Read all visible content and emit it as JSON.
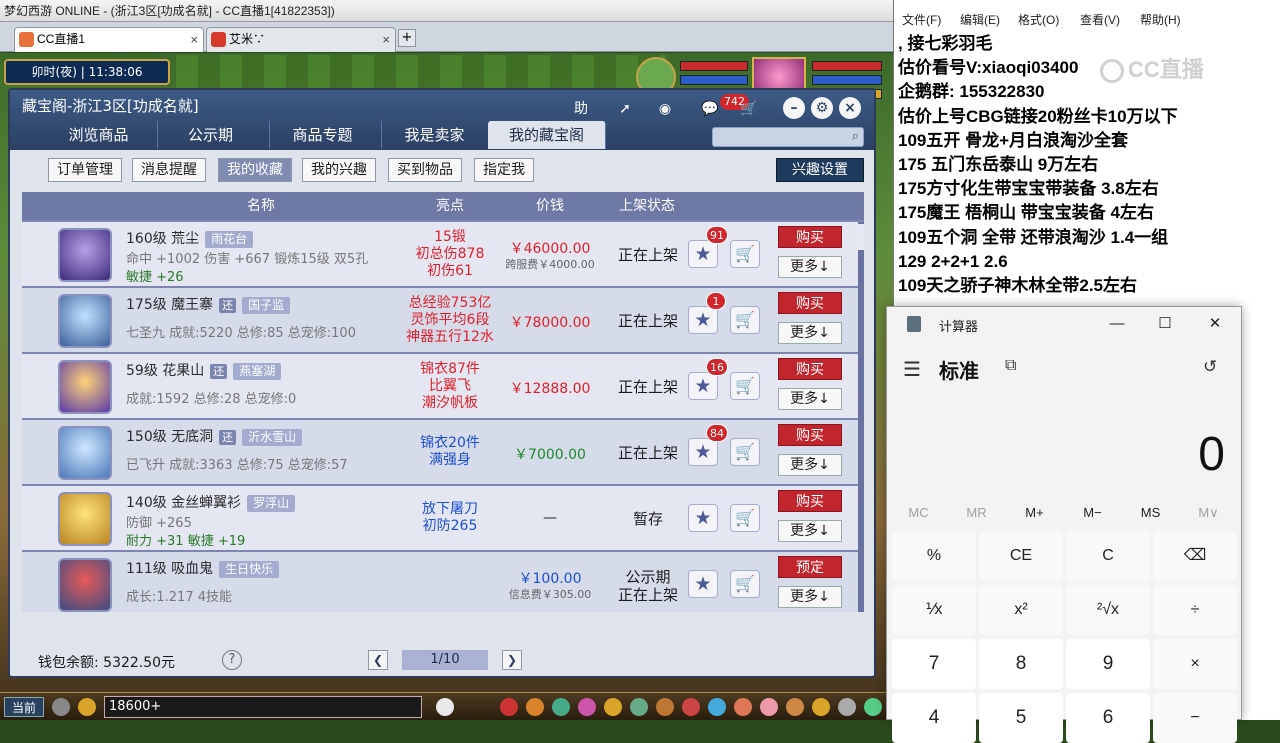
{
  "window": {
    "title": "梦幻西游 ONLINE - (浙江3区[功成名就] - CC直播1[41822353])"
  },
  "browser_tabs": [
    {
      "label": "CC直播1",
      "active": true
    },
    {
      "label": "艾米∵",
      "active": false
    }
  ],
  "browser_new_tab": "+",
  "browser_close": "×",
  "hud": {
    "clock": "卯时(夜) | 11:38:06"
  },
  "dialog": {
    "title": "藏宝阁-浙江3区[功成名就]",
    "header_buttons": {
      "help": "助",
      "message_count": "742"
    },
    "main_tabs": [
      "浏览商品",
      "公示期",
      "商品专题",
      "我是卖家",
      "我的藏宝阁"
    ],
    "active_main_tab": 4,
    "sub_tabs": [
      "订单管理",
      "消息提醒",
      "我的收藏",
      "我的兴趣",
      "买到物品",
      "指定我"
    ],
    "active_sub_tab": 2,
    "interest_settings": "兴趣设置",
    "columns": {
      "name": "名称",
      "highlight": "亮点",
      "price": "价钱",
      "status": "上架状态"
    },
    "buy_label": "购买",
    "preorder_label": "预定",
    "more_label": "更多↓",
    "rows": [
      {
        "level_name": "160级 荒尘",
        "server": "雨花台",
        "tag": "",
        "line2": "命中 +1002 伤害 +667 锻炼15级 双5孔",
        "line3": "敏捷 +26",
        "highlights": [
          "15锻",
          "初总伤878",
          "初伤61"
        ],
        "highlight_color": "red",
        "price": "￥46000.00",
        "price_color": "#e0202c",
        "fee": "跨服费￥4000.00",
        "status": [
          "正在上架"
        ],
        "badge": "91",
        "action": "buy"
      },
      {
        "level_name": "175级 魔王寨",
        "server": "国子监",
        "tag": "还",
        "line2": "七圣九 成就:5220 总修:85 总宠修:100",
        "line3": "",
        "highlights": [
          "总经验753亿",
          "灵饰平均6段",
          "神器五行12水"
        ],
        "highlight_color": "red",
        "price": "￥78000.00",
        "price_color": "#e0202c",
        "fee": "",
        "status": [
          "正在上架"
        ],
        "badge": "1",
        "action": "buy"
      },
      {
        "level_name": "59级 花果山",
        "server": "燕塞湖",
        "tag": "还",
        "line2": "成就:1592 总修:28 总宠修:0",
        "line3": "",
        "highlights": [
          "锦衣87件",
          "比翼飞",
          "潮汐帆板"
        ],
        "highlight_color": "red",
        "price": "￥12888.00",
        "price_color": "#e0202c",
        "fee": "",
        "status": [
          "正在上架"
        ],
        "badge": "16",
        "action": "buy"
      },
      {
        "level_name": "150级 无底洞",
        "server": "沂水雪山",
        "tag": "还",
        "line2": "已飞升 成就:3363 总修:75 总宠修:57",
        "line3": "",
        "highlights": [
          "锦衣20件",
          "满强身"
        ],
        "highlight_color": "blue",
        "price": "￥7000.00",
        "price_color": "#1b8a2c",
        "fee": "",
        "status": [
          "正在上架"
        ],
        "badge": "84",
        "action": "buy"
      },
      {
        "level_name": "140级 金丝蝉翼衫",
        "server": "罗浮山",
        "tag": "",
        "line2": "防御 +265",
        "line3": "耐力 +31 敏捷 +19",
        "highlights": [
          "放下屠刀",
          "初防265"
        ],
        "highlight_color": "blue",
        "price": "—",
        "price_color": "#222",
        "fee": "",
        "status": [
          "暂存"
        ],
        "badge": "",
        "action": "buy"
      },
      {
        "level_name": "111级 吸血鬼",
        "server": "生日快乐",
        "tag": "",
        "line2": "成长:1.217 4技能",
        "line3": "",
        "highlights": [],
        "highlight_color": "blue",
        "price": "￥100.00",
        "price_color": "#1e4ed0",
        "fee": "信息费￥305.00",
        "status": [
          "公示期",
          "正在上架"
        ],
        "badge": "",
        "action": "preorder"
      }
    ],
    "wallet": "钱包余额: 5322.50元",
    "help": "?",
    "page": "1/10"
  },
  "bottombar": {
    "current": "当前",
    "chat_value": "18600+"
  },
  "notepad": {
    "menu": [
      "文件(F)",
      "编辑(E)",
      "格式(O)",
      "查看(V)",
      "帮助(H)"
    ],
    "lines": [
      ",      接七彩羽毛",
      "估价看号V:xiaoqi03400",
      "企鹅群: 155322830",
      "估价上号CBG链接20粉丝卡10万以下",
      "109五开 骨龙+月白浪淘沙全套",
      "175 五门东岳泰山  9万左右",
      "175方寸化生带宝宝带装备  3.8左右",
      "175魔王 梧桐山  带宝宝装备 4左右",
      "109五个洞 全带 还带浪淘沙  1.4一组",
      "129 2+2+1  2.6",
      "109天之骄子神木林全带2.5左右"
    ],
    "watermark": "CC直播"
  },
  "calculator": {
    "title": "计算器",
    "mode": "标准",
    "display": "0",
    "memory": [
      {
        "label": "MC",
        "enabled": false
      },
      {
        "label": "MR",
        "enabled": false
      },
      {
        "label": "M+",
        "enabled": true
      },
      {
        "label": "M−",
        "enabled": true
      },
      {
        "label": "MS",
        "enabled": true
      },
      {
        "label": "M∨",
        "enabled": false
      }
    ],
    "keys": [
      [
        "%",
        "CE",
        "C",
        "⌫"
      ],
      [
        "⅟x",
        "x²",
        "²√x",
        "÷"
      ],
      [
        "7",
        "8",
        "9",
        "×"
      ],
      [
        "4",
        "5",
        "6",
        "−"
      ]
    ]
  }
}
